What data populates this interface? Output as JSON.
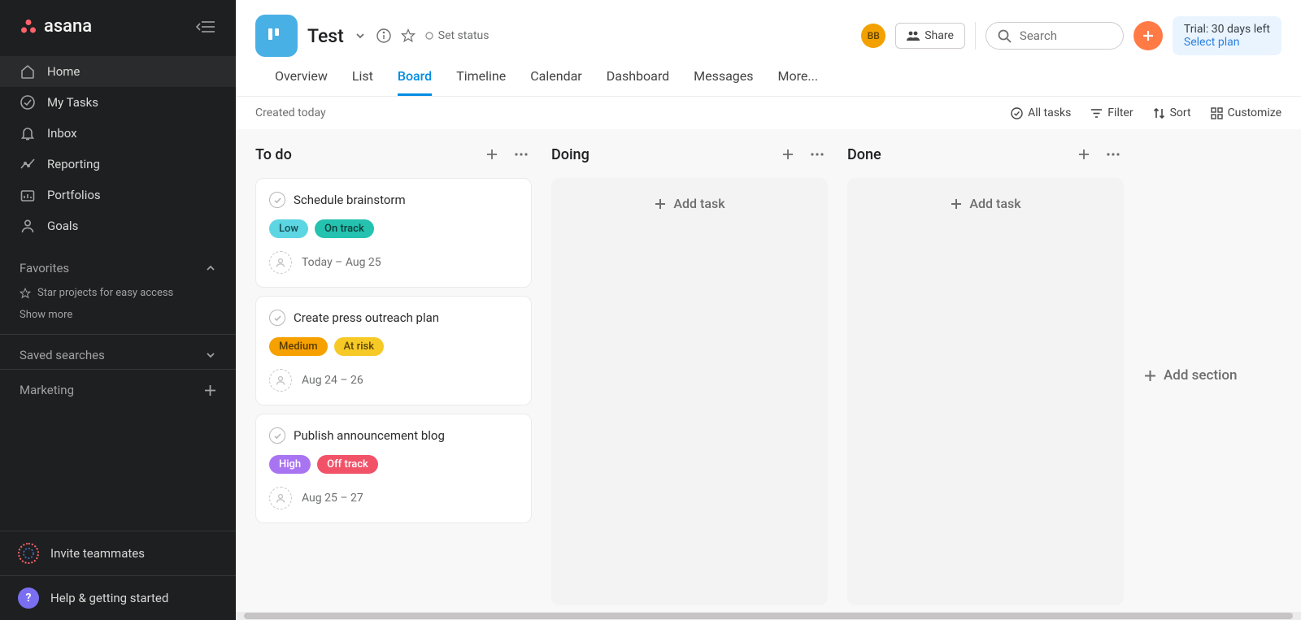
{
  "app_name": "asana",
  "sidebar": {
    "nav": [
      {
        "label": "Home",
        "active": true,
        "icon": "home-icon"
      },
      {
        "label": "My Tasks",
        "active": false,
        "icon": "check-circle-icon"
      },
      {
        "label": "Inbox",
        "active": false,
        "icon": "bell-icon"
      },
      {
        "label": "Reporting",
        "active": false,
        "icon": "trend-icon"
      },
      {
        "label": "Portfolios",
        "active": false,
        "icon": "portfolio-icon"
      },
      {
        "label": "Goals",
        "active": false,
        "icon": "person-icon"
      }
    ],
    "favorites_label": "Favorites",
    "favorites_hint": "Star projects for easy access",
    "show_more": "Show more",
    "saved_searches_label": "Saved searches",
    "workspace_label": "Marketing",
    "invite_label": "Invite teammates",
    "help_label": "Help & getting started"
  },
  "project": {
    "title": "Test",
    "set_status_label": "Set status",
    "share_label": "Share",
    "user_initials": "BB",
    "search_placeholder": "Search"
  },
  "trial": {
    "line1": "Trial: 30 days left",
    "line2": "Select plan"
  },
  "tabs": [
    "Overview",
    "List",
    "Board",
    "Timeline",
    "Calendar",
    "Dashboard",
    "Messages",
    "More..."
  ],
  "active_tab": "Board",
  "toolbar": {
    "created": "Created today",
    "all_tasks": "All tasks",
    "filter": "Filter",
    "sort": "Sort",
    "customize": "Customize"
  },
  "board": {
    "add_section": "Add section",
    "add_task": "Add task",
    "columns": [
      {
        "title": "To do",
        "cards": [
          {
            "title": "Schedule brainstorm",
            "tags": [
              {
                "text": "Low",
                "bg": "#5bd6e2",
                "fg": "#174b52"
              },
              {
                "text": "On track",
                "bg": "#25c2b0",
                "fg": "#0a3f38"
              }
            ],
            "date": "Today – Aug 25"
          },
          {
            "title": "Create press outreach plan",
            "tags": [
              {
                "text": "Medium",
                "bg": "#f6a100",
                "fg": "#5b3c00"
              },
              {
                "text": "At risk",
                "bg": "#f6c927",
                "fg": "#5b4500"
              }
            ],
            "date": "Aug 24 – 26"
          },
          {
            "title": "Publish announcement blog",
            "tags": [
              {
                "text": "High",
                "bg": "#a974f1",
                "fg": "#ffffff"
              },
              {
                "text": "Off track",
                "bg": "#f15268",
                "fg": "#ffffff"
              }
            ],
            "date": "Aug 25 – 27"
          }
        ]
      },
      {
        "title": "Doing",
        "cards": []
      },
      {
        "title": "Done",
        "cards": []
      }
    ]
  }
}
